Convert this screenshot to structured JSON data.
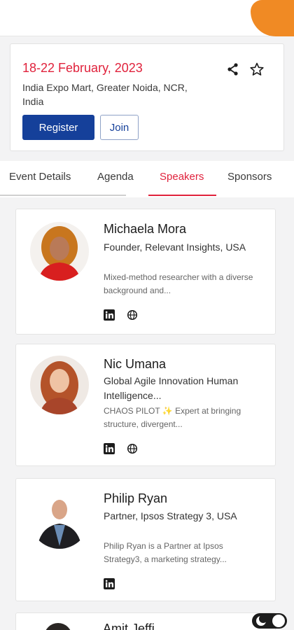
{
  "event": {
    "date": "18-22 February, 2023",
    "venue": "India Expo Mart, Greater Noida, NCR, India",
    "register_label": "Register",
    "join_label": "Join"
  },
  "tabs": [
    {
      "label": "Event Details",
      "active": false
    },
    {
      "label": "Agenda",
      "active": false
    },
    {
      "label": "Speakers",
      "active": true
    },
    {
      "label": "Sponsors",
      "active": false
    }
  ],
  "speakers": [
    {
      "name": "Michaela Mora",
      "title": "Founder, Relevant Insights, USA",
      "bio": "Mixed-method researcher with a diverse background and...",
      "links": [
        "linkedin-icon",
        "globe-icon"
      ]
    },
    {
      "name": "Nic Umana",
      "title": "Global Agile Innovation Human Intelligence...",
      "bio": "CHAOS PILOT ✨ Expert at bringing structure, divergent...",
      "links": [
        "linkedin-icon",
        "globe-icon"
      ]
    },
    {
      "name": "Philip Ryan",
      "title": "Partner, Ipsos Strategy 3, USA",
      "bio": "Philip Ryan is a Partner at Ipsos Strategy3, a marketing strategy...",
      "links": [
        "linkedin-icon"
      ]
    }
  ],
  "partial_next_speaker": "Amit Jeffi...",
  "colors": {
    "accent_red": "#e0223c",
    "primary_blue": "#15409a",
    "orange": "#f08a24"
  }
}
